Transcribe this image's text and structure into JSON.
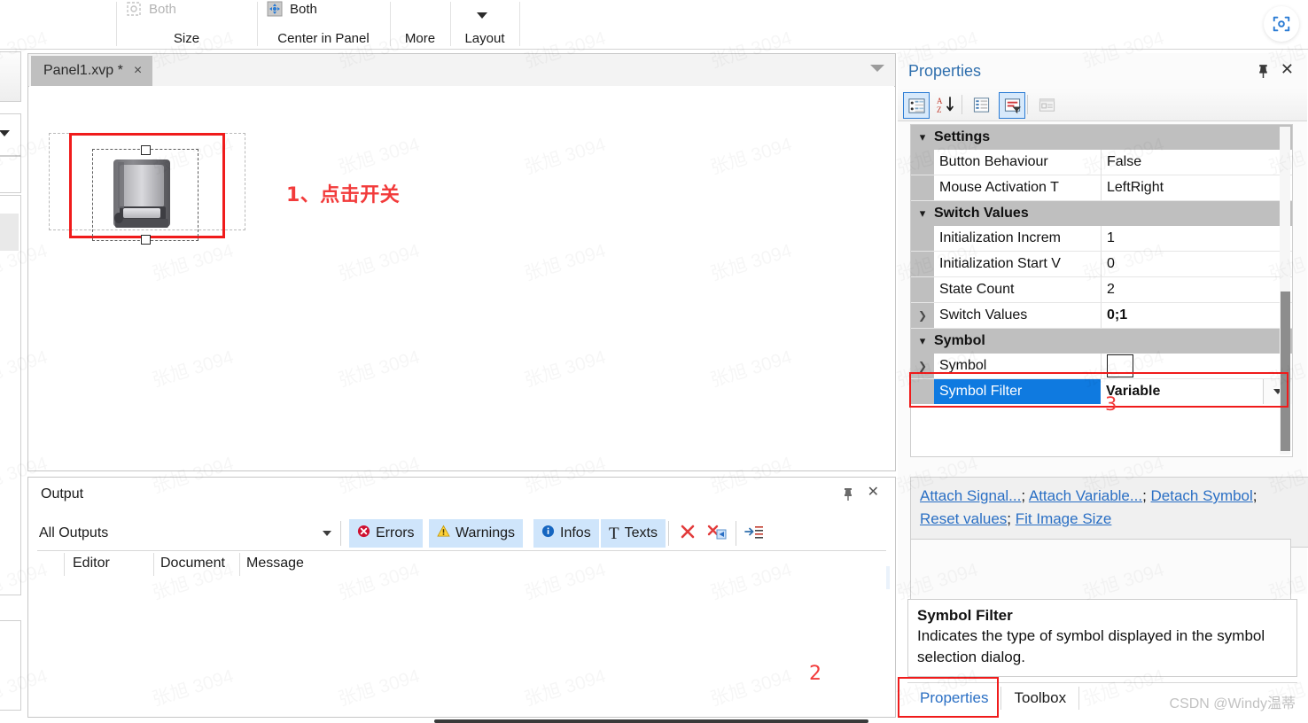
{
  "ribbon": {
    "items": [
      {
        "label": "Both",
        "icon": "size-both-icon",
        "disabled": true
      },
      {
        "label": "Both",
        "icon": "center-both-icon",
        "disabled": false
      }
    ],
    "groups": [
      {
        "label": "Size"
      },
      {
        "label": "Center in Panel"
      },
      {
        "label": "More"
      },
      {
        "label": "Layout"
      }
    ]
  },
  "editor": {
    "tab": {
      "label": "Panel1.xvp *",
      "close": "×"
    },
    "annotation1": "1、点击开关"
  },
  "output": {
    "title": "Output",
    "filter_selected": "All Outputs",
    "buttons": [
      {
        "label": "Errors",
        "icon": "error-icon"
      },
      {
        "label": "Warnings",
        "icon": "warning-icon"
      },
      {
        "label": "Infos",
        "icon": "info-icon"
      },
      {
        "label": "Texts",
        "icon": "text-icon"
      }
    ],
    "tool_icons": [
      "clear-icon",
      "clear-filtered-icon",
      "wrap-text-icon"
    ],
    "columns": [
      "Editor",
      "Document",
      "Message"
    ],
    "annotation2": "2"
  },
  "properties": {
    "title": "Properties",
    "toolbar_icons": [
      "categorized-icon",
      "alphabetical-sort-icon",
      "property-pages-icon",
      "filter-icon",
      "description-icon"
    ],
    "groups": [
      {
        "name": "Settings",
        "rows": [
          {
            "name": "Button Behaviour",
            "value": "False",
            "expandable": false,
            "bold": false
          },
          {
            "name": "Mouse Activation T",
            "value": "LeftRight",
            "expandable": false,
            "bold": false
          }
        ]
      },
      {
        "name": "Switch Values",
        "rows": [
          {
            "name": "Initialization Increm",
            "value": "1",
            "expandable": false,
            "bold": false
          },
          {
            "name": "Initialization Start V",
            "value": "0",
            "expandable": false,
            "bold": false
          },
          {
            "name": "State Count",
            "value": "2",
            "expandable": false,
            "bold": false
          },
          {
            "name": "Switch Values",
            "value": "0;1",
            "expandable": true,
            "bold": true
          }
        ]
      },
      {
        "name": "Symbol",
        "rows": [
          {
            "name": "Symbol",
            "value": "",
            "expandable": true,
            "bold": false,
            "swatch": true
          },
          {
            "name": "Symbol Filter",
            "value": "Variable",
            "expandable": false,
            "bold": true,
            "selected": true,
            "dropdown": true
          }
        ]
      }
    ],
    "annotation3": "3",
    "links": [
      "Attach Signal...",
      "Attach Variable...",
      "Detach Symbol",
      "Reset values",
      "Fit Image Size"
    ],
    "link_separator": "; "
  },
  "description": {
    "title": "Symbol Filter",
    "text": "Indicates the type of symbol displayed in the symbol selection dialog."
  },
  "bottom_tabs": [
    {
      "label": "Properties",
      "active": true
    },
    {
      "label": "Toolbox",
      "active": false
    }
  ],
  "watermark": {
    "text": "张旭 3094"
  },
  "credit": "CSDN @Windy温蒂",
  "colors": {
    "accent": "#2a6fc4",
    "selection": "#0f7ae0",
    "annotation_red": "#f23b3b",
    "category_header": "#bfbfbf"
  }
}
